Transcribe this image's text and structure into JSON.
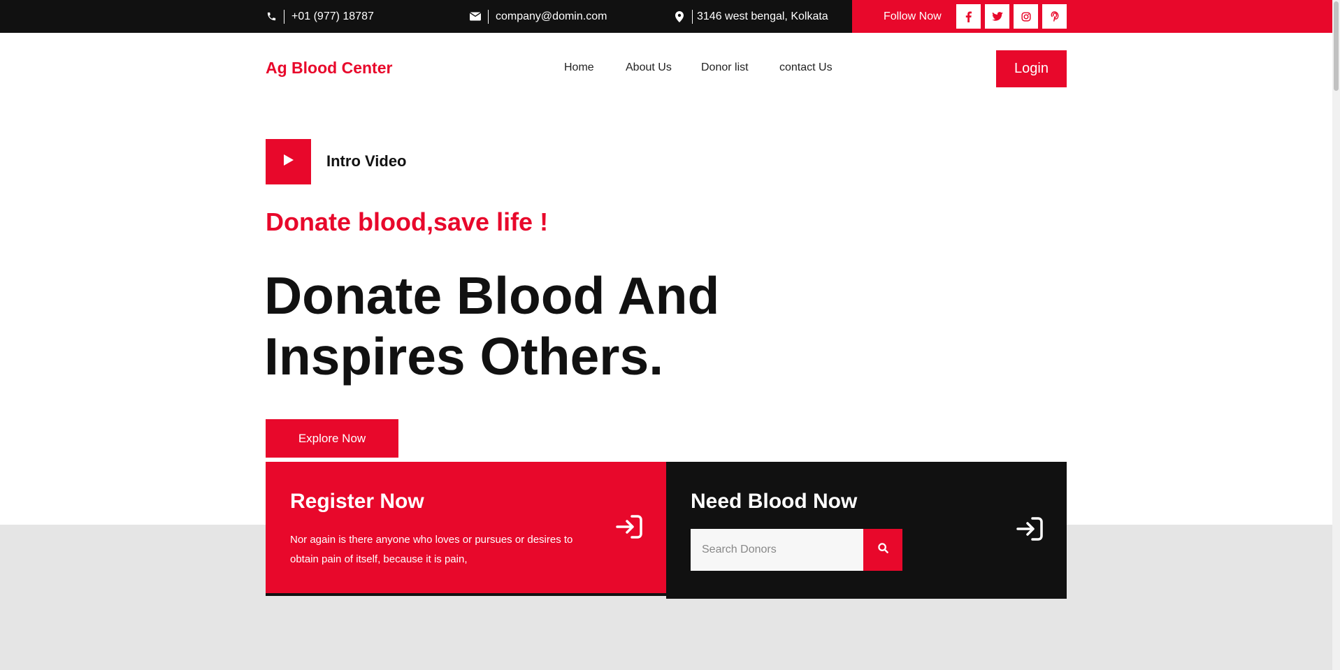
{
  "topbar": {
    "phone": "+01 (977) 18787",
    "email": "company@domin.com",
    "address": "3146 west bengal, Kolkata",
    "follow_label": "Follow Now",
    "social_icons": [
      "facebook-icon",
      "twitter-icon",
      "instagram-icon",
      "pinterest-icon"
    ]
  },
  "header": {
    "logo": "Ag Blood Center",
    "nav": [
      "Home",
      "About Us",
      "Donor list",
      "contact Us"
    ],
    "login_label": "Login"
  },
  "hero": {
    "intro_label": "Intro Video",
    "tagline": "Donate blood,save life !",
    "title_line1": "Donate Blood And",
    "title_line2": "Inspires Others.",
    "explore_label": "Explore Now"
  },
  "cards": {
    "register": {
      "title": "Register Now",
      "text": "Nor again is there anyone who loves or pursues or desires to obtain pain of itself, because it is pain,"
    },
    "need_blood": {
      "title": "Need Blood Now",
      "search_placeholder": "Search Donors"
    }
  },
  "colors": {
    "accent": "#e8082b",
    "dark": "#111111",
    "gray_section": "#e5e5e5"
  }
}
